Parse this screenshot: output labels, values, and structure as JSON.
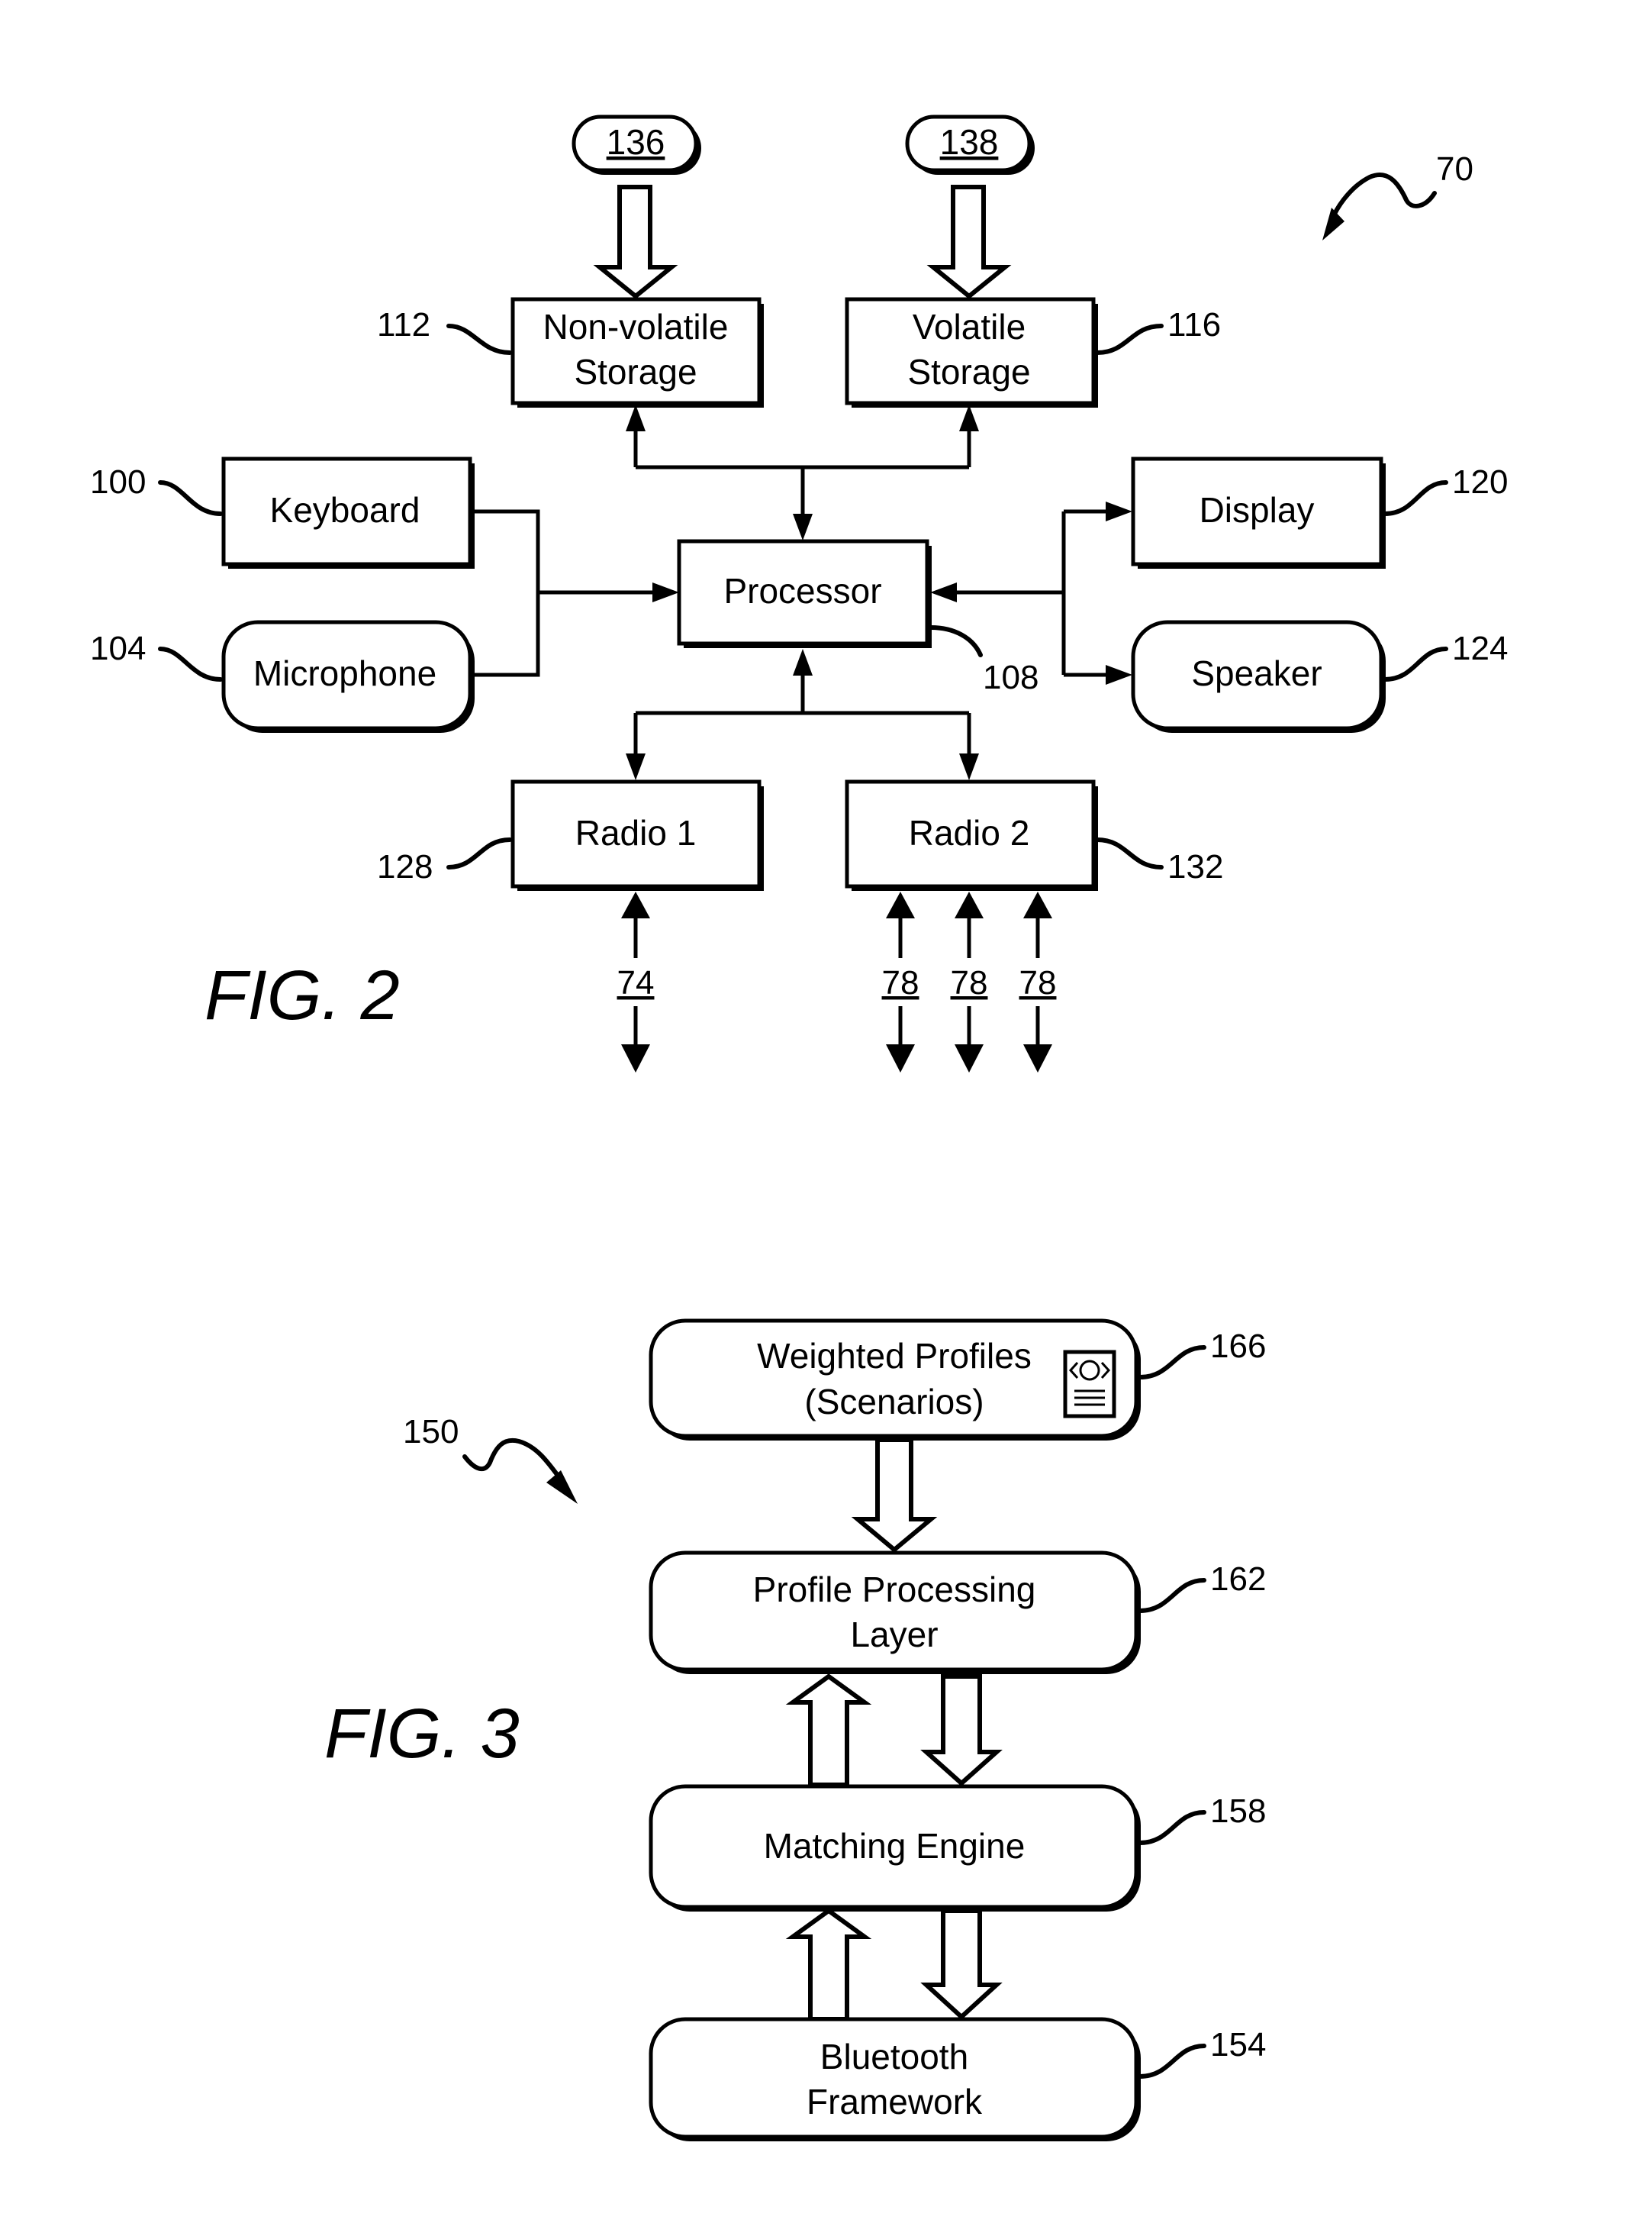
{
  "fig2": {
    "caption": "FIG. 2",
    "system_ref": "70",
    "inputs": [
      {
        "ref": "136"
      },
      {
        "ref": "138"
      }
    ],
    "blocks": {
      "nonvolatile": {
        "line1": "Non-volatile",
        "line2": "Storage",
        "ref": "112"
      },
      "volatile": {
        "line1": "Volatile",
        "line2": "Storage",
        "ref": "116"
      },
      "keyboard": {
        "label": "Keyboard",
        "ref": "100"
      },
      "microphone": {
        "label": "Microphone",
        "ref": "104"
      },
      "processor": {
        "label": "Processor",
        "ref": "108"
      },
      "display": {
        "label": "Display",
        "ref": "120"
      },
      "speaker": {
        "label": "Speaker",
        "ref": "124"
      },
      "radio1": {
        "label": "Radio 1",
        "ref": "128"
      },
      "radio2": {
        "label": "Radio 2",
        "ref": "132"
      }
    },
    "links": {
      "radio1": [
        "74"
      ],
      "radio2": [
        "78",
        "78",
        "78"
      ]
    }
  },
  "fig3": {
    "caption": "FIG. 3",
    "system_ref": "150",
    "layers": [
      {
        "line1": "Weighted Profiles",
        "line2": "(Scenarios)",
        "ref": "166",
        "icon": "document-eye-icon"
      },
      {
        "line1": "Profile Processing",
        "line2": "Layer",
        "ref": "162"
      },
      {
        "line1": "Matching Engine",
        "line2": "",
        "ref": "158"
      },
      {
        "line1": "Bluetooth",
        "line2": "Framework",
        "ref": "154"
      }
    ]
  }
}
